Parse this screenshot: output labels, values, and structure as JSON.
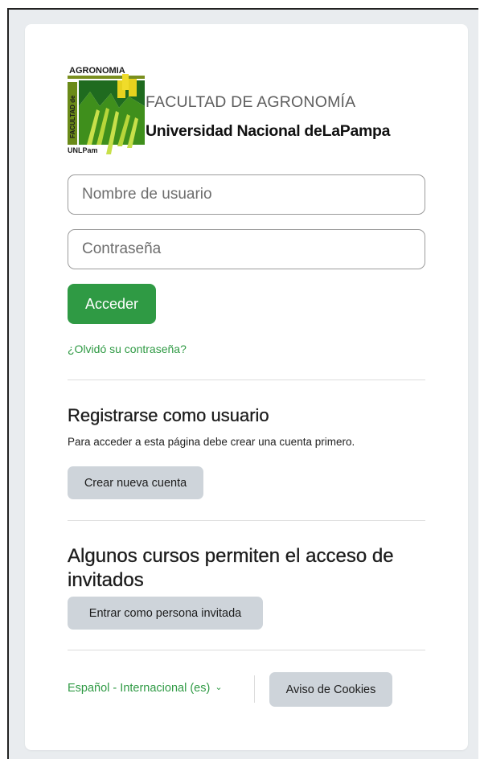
{
  "logo": {
    "emblem_text_top": "AGRONOMIA",
    "emblem_text_side": "FACULTAD de",
    "emblem_text_bottom": "UNLPam",
    "line1": "FACULTAD DE AGRONOMÍA",
    "line2": "Universidad Nacional deLaPampa"
  },
  "login": {
    "username_placeholder": "Nombre de usuario",
    "password_placeholder": "Contraseña",
    "submit_label": "Acceder",
    "forgot_link": "¿Olvidó su contraseña?"
  },
  "signup": {
    "heading": "Registrarse como usuario",
    "note": "Para acceder a esta página debe crear una cuenta primero.",
    "button": "Crear nueva cuenta"
  },
  "guest": {
    "heading": "Algunos cursos permiten el acceso de invitados",
    "button": "Entrar como persona invitada"
  },
  "footer": {
    "language": "Español - Internacional (es)",
    "cookies_button": "Aviso de Cookies"
  },
  "colors": {
    "primary": "#2f9a44",
    "secondary_button": "#ced4da",
    "page_bg": "#e9ecef"
  }
}
